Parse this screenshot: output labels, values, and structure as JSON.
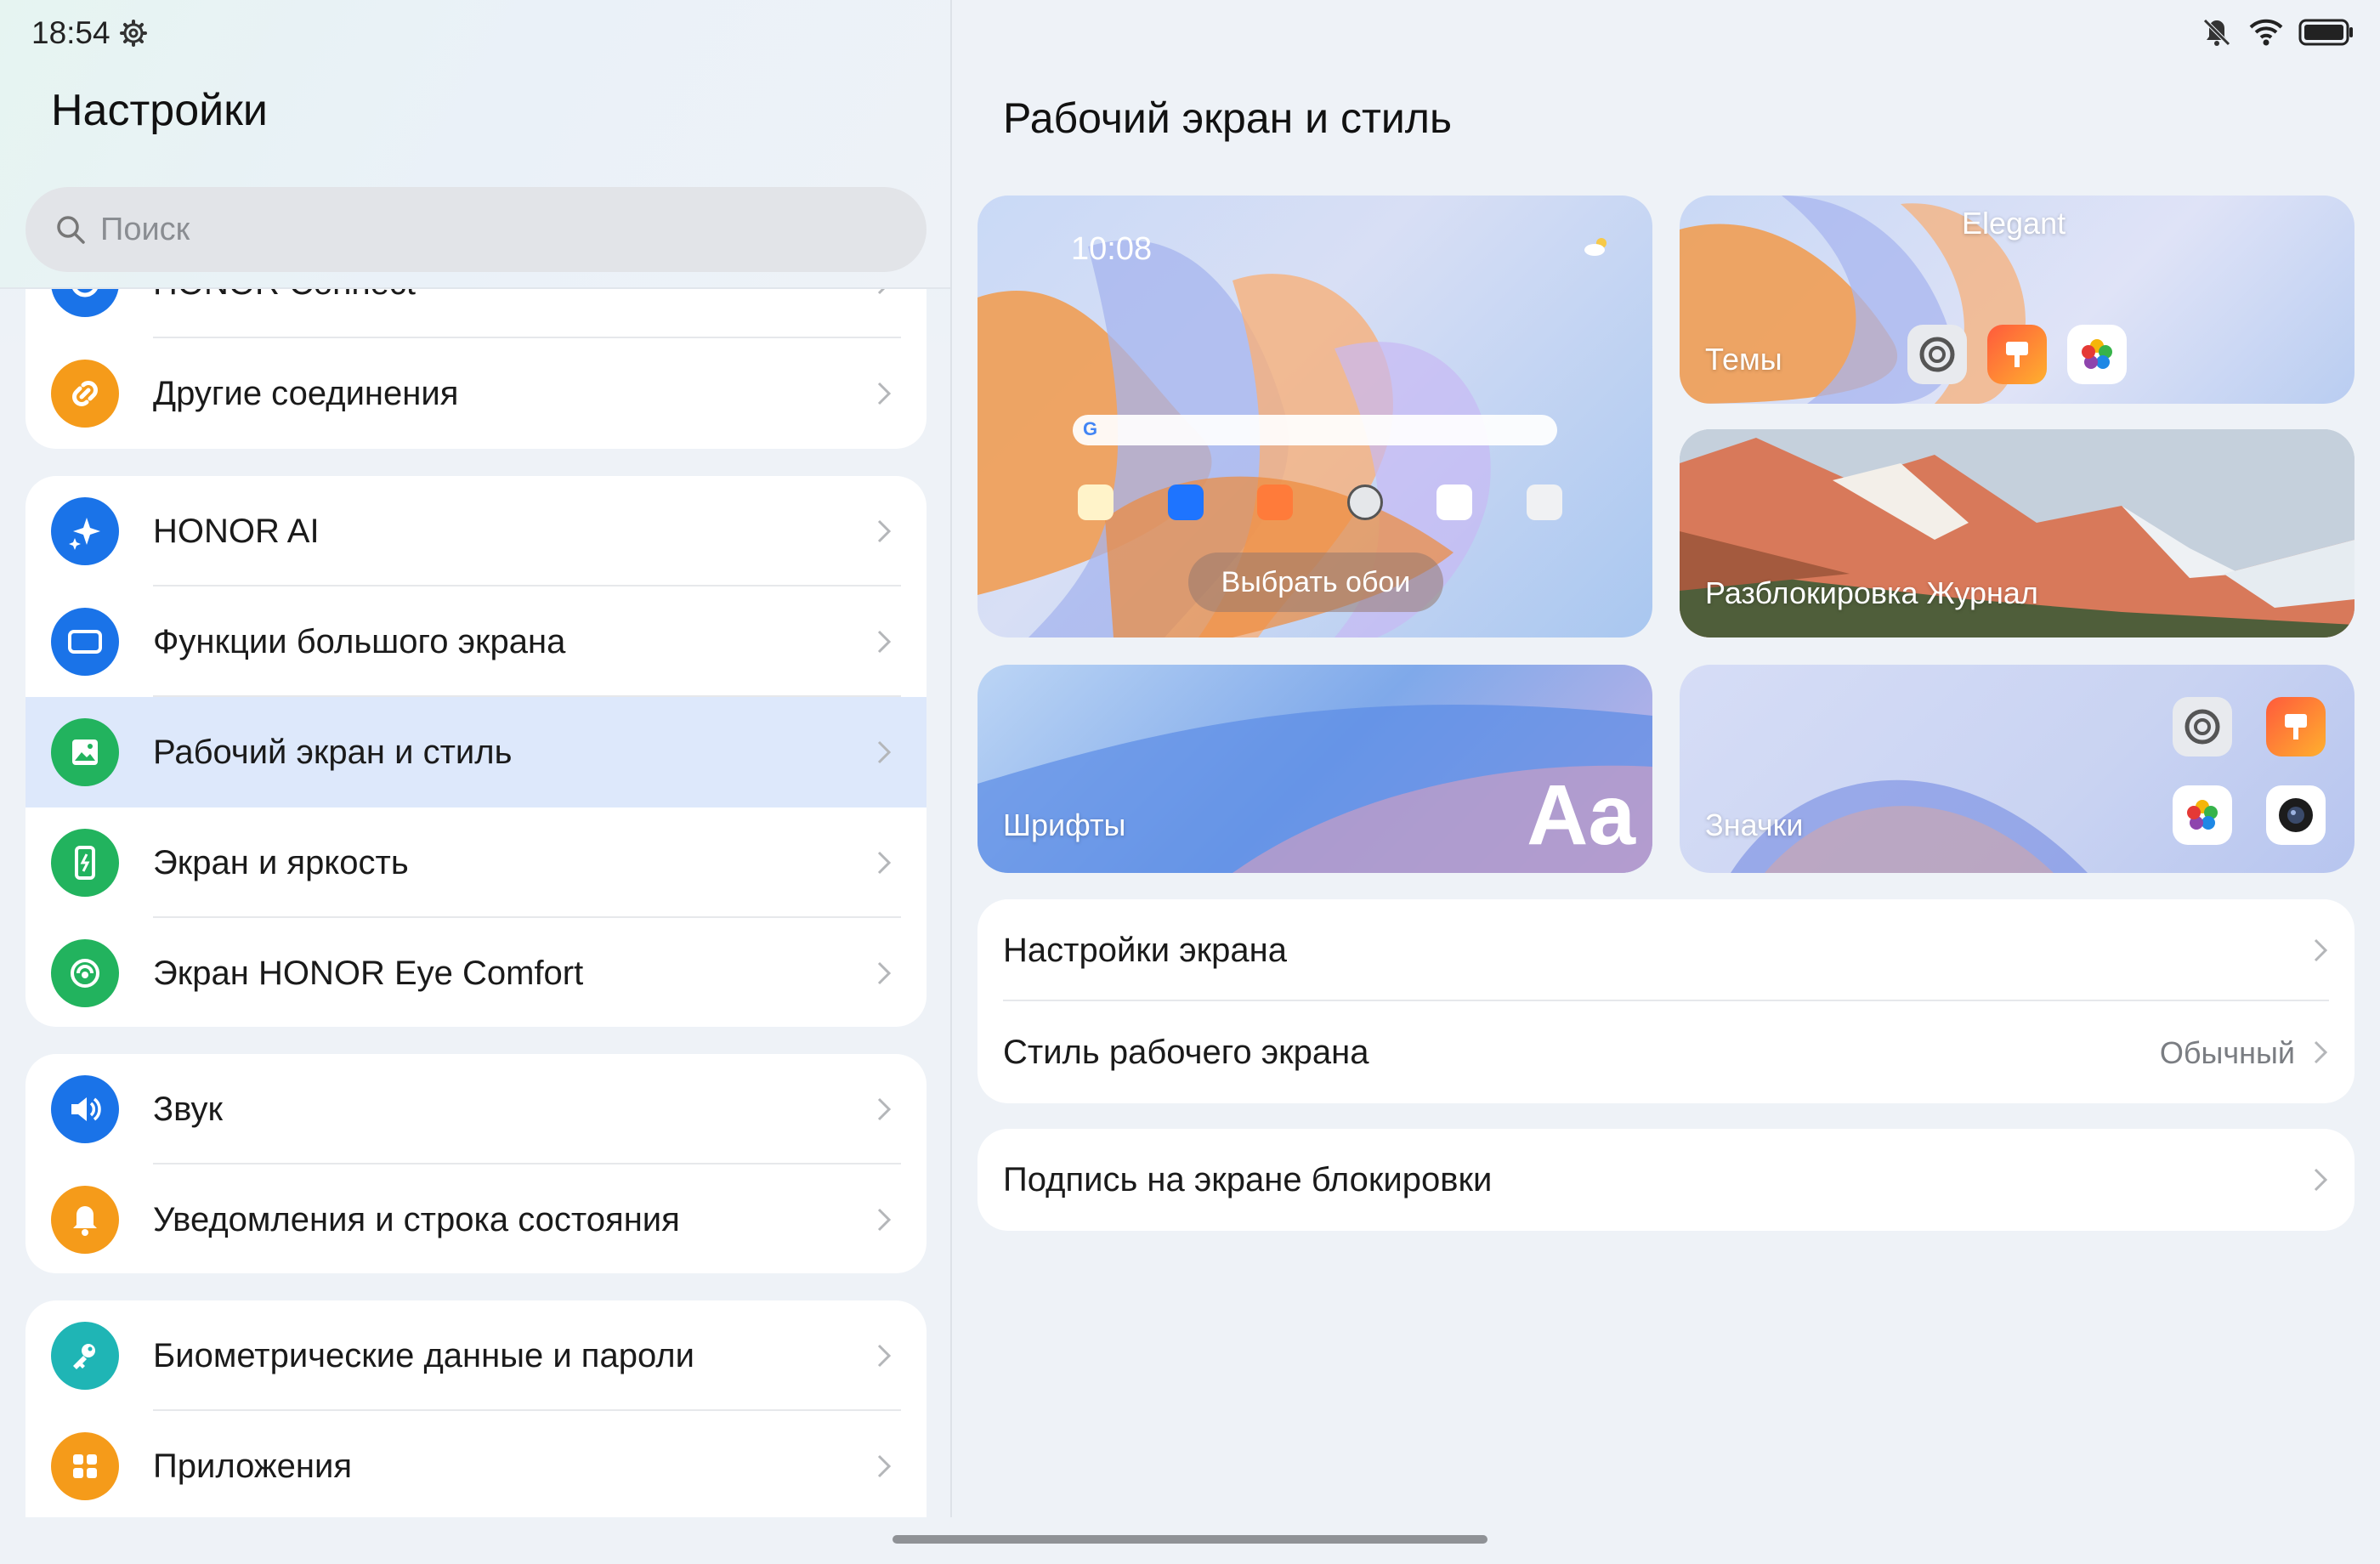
{
  "status_bar": {
    "time": "18:54",
    "icons": [
      "gear-icon",
      "bell-muted-icon",
      "wifi-icon",
      "battery-icon"
    ]
  },
  "left": {
    "title": "Настройки",
    "search_placeholder": "Поиск",
    "groups": [
      {
        "items": [
          {
            "label": "HONOR Connect",
            "icon": "connect-icon",
            "color": "#1a73e8"
          },
          {
            "label": "Другие соединения",
            "icon": "link-icon",
            "color": "#f59b1a"
          }
        ]
      },
      {
        "items": [
          {
            "label": "HONOR AI",
            "icon": "sparkle-icon",
            "color": "#1a73e8"
          },
          {
            "label": "Функции большого экрана",
            "icon": "tablet-icon",
            "color": "#1a73e8"
          },
          {
            "label": "Рабочий экран и стиль",
            "icon": "image-icon",
            "color": "#22b35e",
            "active": true
          },
          {
            "label": "Экран и яркость",
            "icon": "phone-brightness-icon",
            "color": "#22b35e"
          },
          {
            "label": "Экран HONOR Eye Comfort",
            "icon": "eye-comfort-icon",
            "color": "#22b35e"
          }
        ]
      },
      {
        "items": [
          {
            "label": "Звук",
            "icon": "speaker-icon",
            "color": "#1a73e8"
          },
          {
            "label": "Уведомления и строка состояния",
            "icon": "bell-icon",
            "color": "#f59b1a"
          }
        ]
      },
      {
        "items": [
          {
            "label": "Биометрические данные и пароли",
            "icon": "key-icon",
            "color": "#1fb5b5"
          },
          {
            "label": "Приложения",
            "icon": "apps-icon",
            "color": "#f59b1a"
          }
        ]
      }
    ]
  },
  "right": {
    "title": "Рабочий экран и стиль",
    "tiles": {
      "wallpaper": {
        "clock": "10:08",
        "button": "Выбрать обои"
      },
      "themes": {
        "label": "Темы",
        "theme_name": "Elegant"
      },
      "lock": {
        "label": "Разблокировка Журнал"
      },
      "fonts": {
        "label": "Шрифты",
        "sample": "Aa"
      },
      "icons": {
        "label": "Значки"
      }
    },
    "card1": [
      {
        "label": "Настройки экрана",
        "value": ""
      },
      {
        "label": "Стиль рабочего экрана",
        "value": "Обычный"
      }
    ],
    "card2": [
      {
        "label": "Подпись на экране блокировки"
      }
    ]
  }
}
